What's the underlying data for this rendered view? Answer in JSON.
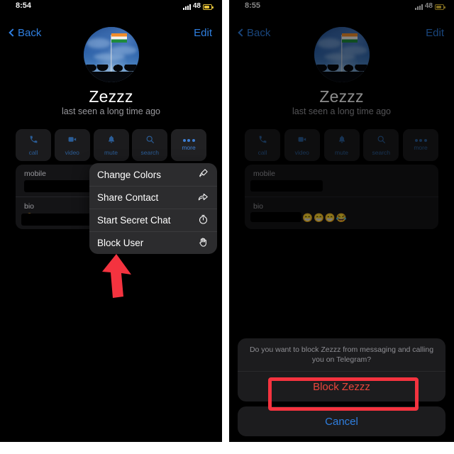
{
  "annotation": {
    "accent_color": "#f4333f",
    "arrow_name": "red-up-arrow-pointing-to-block-user",
    "rect_name": "red-highlight-rect-around-block-zezzz"
  },
  "theme": {
    "background": "#000000",
    "menu_bg": "#2c2c2e",
    "card_bg": "#141416",
    "accent_blue": "#2f7fe0",
    "destructive_red": "#e8453c",
    "muted_text": "#98989d"
  },
  "left_phone": {
    "statusbar": {
      "time": "8:54",
      "battery": "48",
      "signal_icon": "signal-bars-icon",
      "battery_icon": "battery-icon"
    },
    "navbar": {
      "back_label": "Back",
      "back_icon": "chevron-left-icon",
      "edit_label": "Edit"
    },
    "profile": {
      "avatar_icon": "avatar-indian-flag-photo",
      "name": "Zezzz",
      "status": "last seen a long time ago"
    },
    "actions": [
      {
        "label": "call",
        "icon": "phone-icon",
        "active": false
      },
      {
        "label": "video",
        "icon": "video-icon",
        "active": false
      },
      {
        "label": "mute",
        "icon": "bell-icon",
        "active": false
      },
      {
        "label": "search",
        "icon": "search-icon",
        "active": false
      },
      {
        "label": "more",
        "icon": "ellipsis-icon",
        "active": true
      }
    ],
    "info": [
      {
        "label": "mobile",
        "value": "",
        "redacted": true
      },
      {
        "label": "bio",
        "value": "",
        "redacted": true,
        "emoji": "😁"
      }
    ],
    "context_menu": [
      {
        "label": "Change Colors",
        "icon": "paintbrush-icon"
      },
      {
        "label": "Share Contact",
        "icon": "share-arrow-icon"
      },
      {
        "label": "Start Secret Chat",
        "icon": "timer-icon"
      },
      {
        "label": "Block User",
        "icon": "hand-raised-icon"
      }
    ]
  },
  "right_phone": {
    "statusbar": {
      "time": "8:55",
      "battery": "48",
      "signal_icon": "signal-bars-icon",
      "battery_icon": "battery-icon"
    },
    "navbar": {
      "back_label": "Back",
      "back_icon": "chevron-left-icon",
      "edit_label": "Edit"
    },
    "profile": {
      "avatar_icon": "avatar-indian-flag-photo",
      "name": "Zezzz",
      "status": "last seen a long time ago"
    },
    "actions": [
      {
        "label": "call",
        "icon": "phone-icon",
        "active": false
      },
      {
        "label": "video",
        "icon": "video-icon",
        "active": false
      },
      {
        "label": "mute",
        "icon": "bell-icon",
        "active": false
      },
      {
        "label": "search",
        "icon": "search-icon",
        "active": false
      },
      {
        "label": "more",
        "icon": "ellipsis-icon",
        "active": false
      }
    ],
    "info": [
      {
        "label": "mobile",
        "value": "",
        "redacted": true
      },
      {
        "label": "bio",
        "value": "",
        "redacted": true,
        "emoji": "😁😁😁😂"
      }
    ],
    "action_sheet": {
      "message": "Do you want to block Zezzz from messaging and calling you on Telegram?",
      "block_label": "Block Zezzz",
      "cancel_label": "Cancel"
    }
  }
}
